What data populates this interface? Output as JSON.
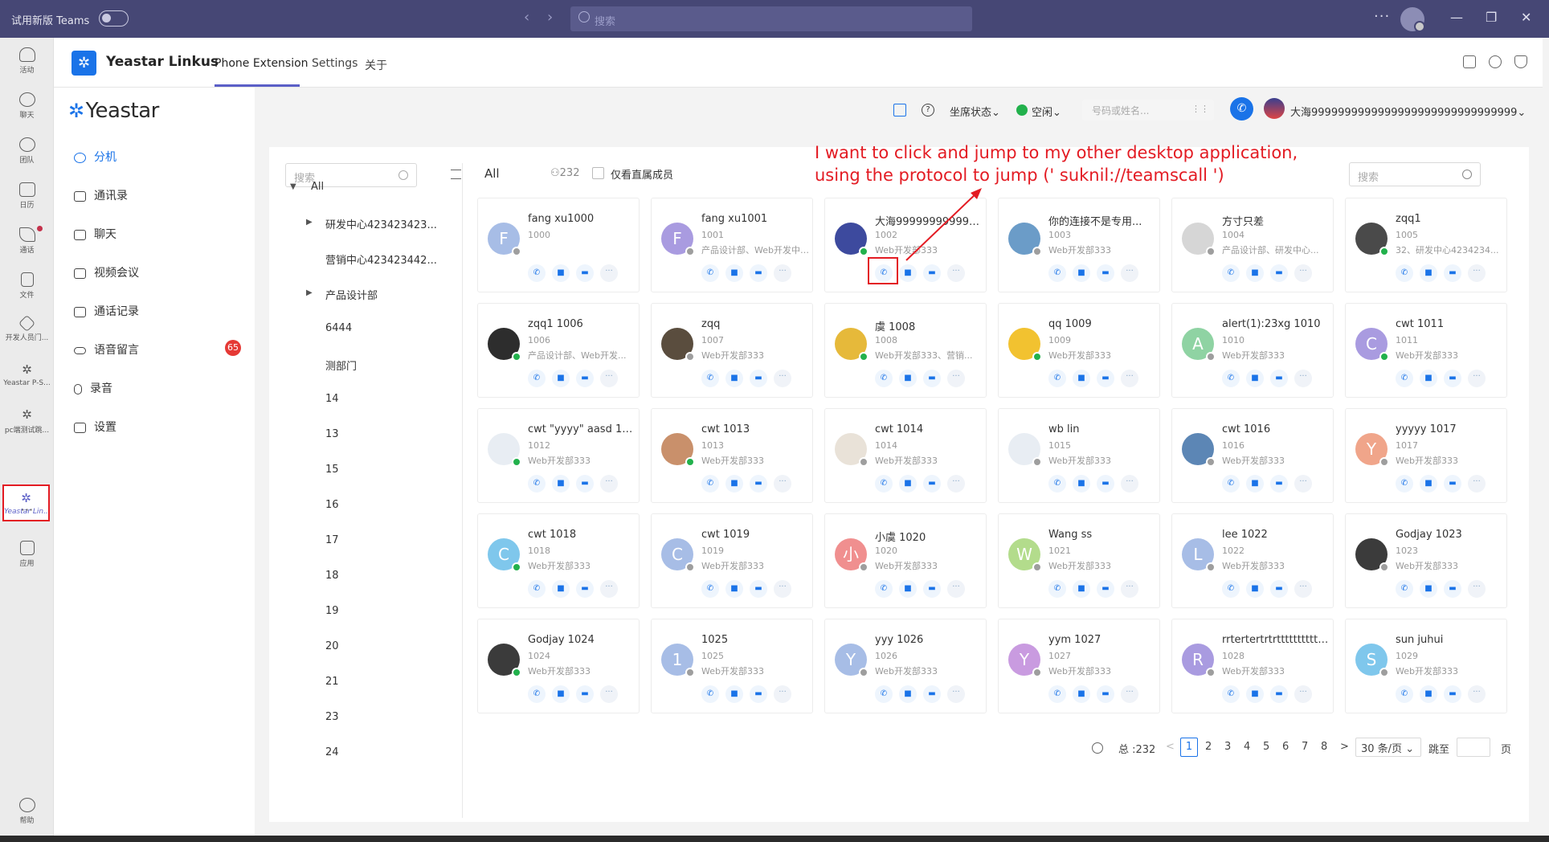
{
  "titlebar": {
    "label": "试用新版 Teams",
    "search_placeholder": "搜索",
    "more": "···"
  },
  "rail": [
    {
      "label": "活动"
    },
    {
      "label": "聊天"
    },
    {
      "label": "团队"
    },
    {
      "label": "日历"
    },
    {
      "label": "通话"
    },
    {
      "label": "文件"
    },
    {
      "label": "开发人员门..."
    },
    {
      "label": "Yeastar P-S..."
    },
    {
      "label": "pc端测试跳..."
    },
    {
      "label": "Yeastar Lin..."
    },
    {
      "label": "···"
    },
    {
      "label": "应用"
    },
    {
      "label": "帮助"
    }
  ],
  "header": {
    "app_title": "Yeastar Linkus",
    "tabs": [
      "Phone Extension",
      "Settings",
      "关于"
    ]
  },
  "sidebar": {
    "logo": "Yeastar",
    "items": [
      {
        "label": "分机"
      },
      {
        "label": "通讯录"
      },
      {
        "label": "聊天"
      },
      {
        "label": "视频会议"
      },
      {
        "label": "通话记录"
      },
      {
        "label": "语音留言"
      },
      {
        "label": "录音"
      },
      {
        "label": "设置"
      }
    ],
    "voicemail_badge": "65"
  },
  "status": {
    "agent_status": "坐席状态",
    "presence": "空闲",
    "number_placeholder": "号码或姓名...",
    "user_name": "大海9999999999999999999999999999999"
  },
  "tree": {
    "search_placeholder": "搜索",
    "root": "All",
    "nodes": [
      "研发中心423423423...",
      "营销中心423423442...",
      "产品设计部",
      "6444",
      "测部门",
      "14",
      "13",
      "15",
      "16",
      "17",
      "18",
      "19",
      "20",
      "21",
      "23",
      "24"
    ]
  },
  "toolbar": {
    "all": "All",
    "count": "232",
    "direct_members": "仅看直属成员",
    "search_placeholder": "搜索"
  },
  "contacts": [
    {
      "name": "fang xu1000",
      "ext": "1000",
      "dept": "",
      "initial": "F",
      "color": "#a7bde6",
      "online": false
    },
    {
      "name": "fang xu1001",
      "ext": "1001",
      "dept": "产品设计部、Web开发中心...",
      "initial": "F",
      "color": "#a99be0",
      "online": false
    },
    {
      "name": "大海9999999999999...",
      "ext": "1002",
      "dept": "Web开发部333",
      "initial": "",
      "color": "#3d4a9e",
      "online": true
    },
    {
      "name": "你的连接不是专用...",
      "ext": "1003",
      "dept": "Web开发部333",
      "initial": "",
      "color": "#6b9cc8",
      "online": false
    },
    {
      "name": "方寸只差",
      "ext": "1004",
      "dept": "产品设计部、研发中心...",
      "initial": "",
      "color": "#d6d6d6",
      "online": false
    },
    {
      "name": "zqq1",
      "ext": "1005",
      "dept": "32、研发中心4234234...",
      "initial": "",
      "color": "#4a4a4a",
      "online": true
    },
    {
      "name": "zqq1 1006",
      "ext": "1006",
      "dept": "产品设计部、Web开发...",
      "initial": "",
      "color": "#2d2d2d",
      "online": true
    },
    {
      "name": "zqq",
      "ext": "1007",
      "dept": "Web开发部333",
      "initial": "",
      "color": "#5a4d3e",
      "online": false
    },
    {
      "name": "虞 1008",
      "ext": "1008",
      "dept": "Web开发部333、营销...",
      "initial": "",
      "color": "#e6b93a",
      "online": true
    },
    {
      "name": "qq 1009",
      "ext": "1009",
      "dept": "Web开发部333",
      "initial": "",
      "color": "#f2c230",
      "online": true
    },
    {
      "name": "alert(1):23xg 1010",
      "ext": "1010",
      "dept": "Web开发部333",
      "initial": "A",
      "color": "#8fd3a3",
      "online": false
    },
    {
      "name": "cwt 1011",
      "ext": "1011",
      "dept": "Web开发部333",
      "initial": "C",
      "color": "#a99be0",
      "online": true
    },
    {
      "name": "cwt \"yyyy\" aasd 10...",
      "ext": "1012",
      "dept": "Web开发部333",
      "initial": "",
      "color": "#e8edf3",
      "online": true
    },
    {
      "name": "cwt 1013",
      "ext": "1013",
      "dept": "Web开发部333",
      "initial": "",
      "color": "#c9906b",
      "online": true
    },
    {
      "name": "cwt 1014",
      "ext": "1014",
      "dept": "Web开发部333",
      "initial": "",
      "color": "#e9e2d8",
      "online": false
    },
    {
      "name": "wb lin",
      "ext": "1015",
      "dept": "Web开发部333",
      "initial": "",
      "color": "#e8edf3",
      "online": false
    },
    {
      "name": "cwt 1016",
      "ext": "1016",
      "dept": "Web开发部333",
      "initial": "",
      "color": "#5c86b5",
      "online": false
    },
    {
      "name": "yyyyy 1017",
      "ext": "1017",
      "dept": "Web开发部333",
      "initial": "Y",
      "color": "#f0a58a",
      "online": false
    },
    {
      "name": "cwt 1018",
      "ext": "1018",
      "dept": "Web开发部333",
      "initial": "C",
      "color": "#7fc7ec",
      "online": true
    },
    {
      "name": "cwt 1019",
      "ext": "1019",
      "dept": "Web开发部333",
      "initial": "C",
      "color": "#a7bde6",
      "online": false
    },
    {
      "name": "小虞 1020",
      "ext": "1020",
      "dept": "Web开发部333",
      "initial": "小",
      "color": "#f08f8f",
      "online": false
    },
    {
      "name": "Wang ss",
      "ext": "1021",
      "dept": "Web开发部333",
      "initial": "W",
      "color": "#b3dc8c",
      "online": false
    },
    {
      "name": "lee 1022",
      "ext": "1022",
      "dept": "Web开发部333",
      "initial": "L",
      "color": "#a7bde6",
      "online": false
    },
    {
      "name": "Godjay 1023",
      "ext": "1023",
      "dept": "Web开发部333",
      "initial": "",
      "color": "#3b3b3b",
      "online": false
    },
    {
      "name": "Godjay 1024",
      "ext": "1024",
      "dept": "Web开发部333",
      "initial": "",
      "color": "#3b3b3b",
      "online": true
    },
    {
      "name": "1025",
      "ext": "1025",
      "dept": "Web开发部333",
      "initial": "1",
      "color": "#a7bde6",
      "online": false
    },
    {
      "name": "yyy 1026",
      "ext": "1026",
      "dept": "Web开发部333",
      "initial": "Y",
      "color": "#a7bde6",
      "online": false
    },
    {
      "name": "yym 1027",
      "ext": "1027",
      "dept": "Web开发部333",
      "initial": "Y",
      "color": "#c99be0",
      "online": false
    },
    {
      "name": "rrtertertrtrtttttttttttt...",
      "ext": "1028",
      "dept": "Web开发部333",
      "initial": "R",
      "color": "#a99be0",
      "online": false
    },
    {
      "name": "sun juhui",
      "ext": "1029",
      "dept": "Web开发部333",
      "initial": "S",
      "color": "#7fc7ec",
      "online": false
    }
  ],
  "pagination": {
    "total": "总 :232",
    "prev": "<",
    "current": "1",
    "pages": [
      "2",
      "3",
      "4",
      "5",
      "6",
      "7",
      "8"
    ],
    "next": ">",
    "page_size": "30 条/页",
    "jump": "跳至",
    "page_unit": "页"
  },
  "annotation": {
    "line1": "I want to click and jump to my other desktop application,",
    "line2": "using the protocol to jump (' suknil://teamscall ')"
  }
}
